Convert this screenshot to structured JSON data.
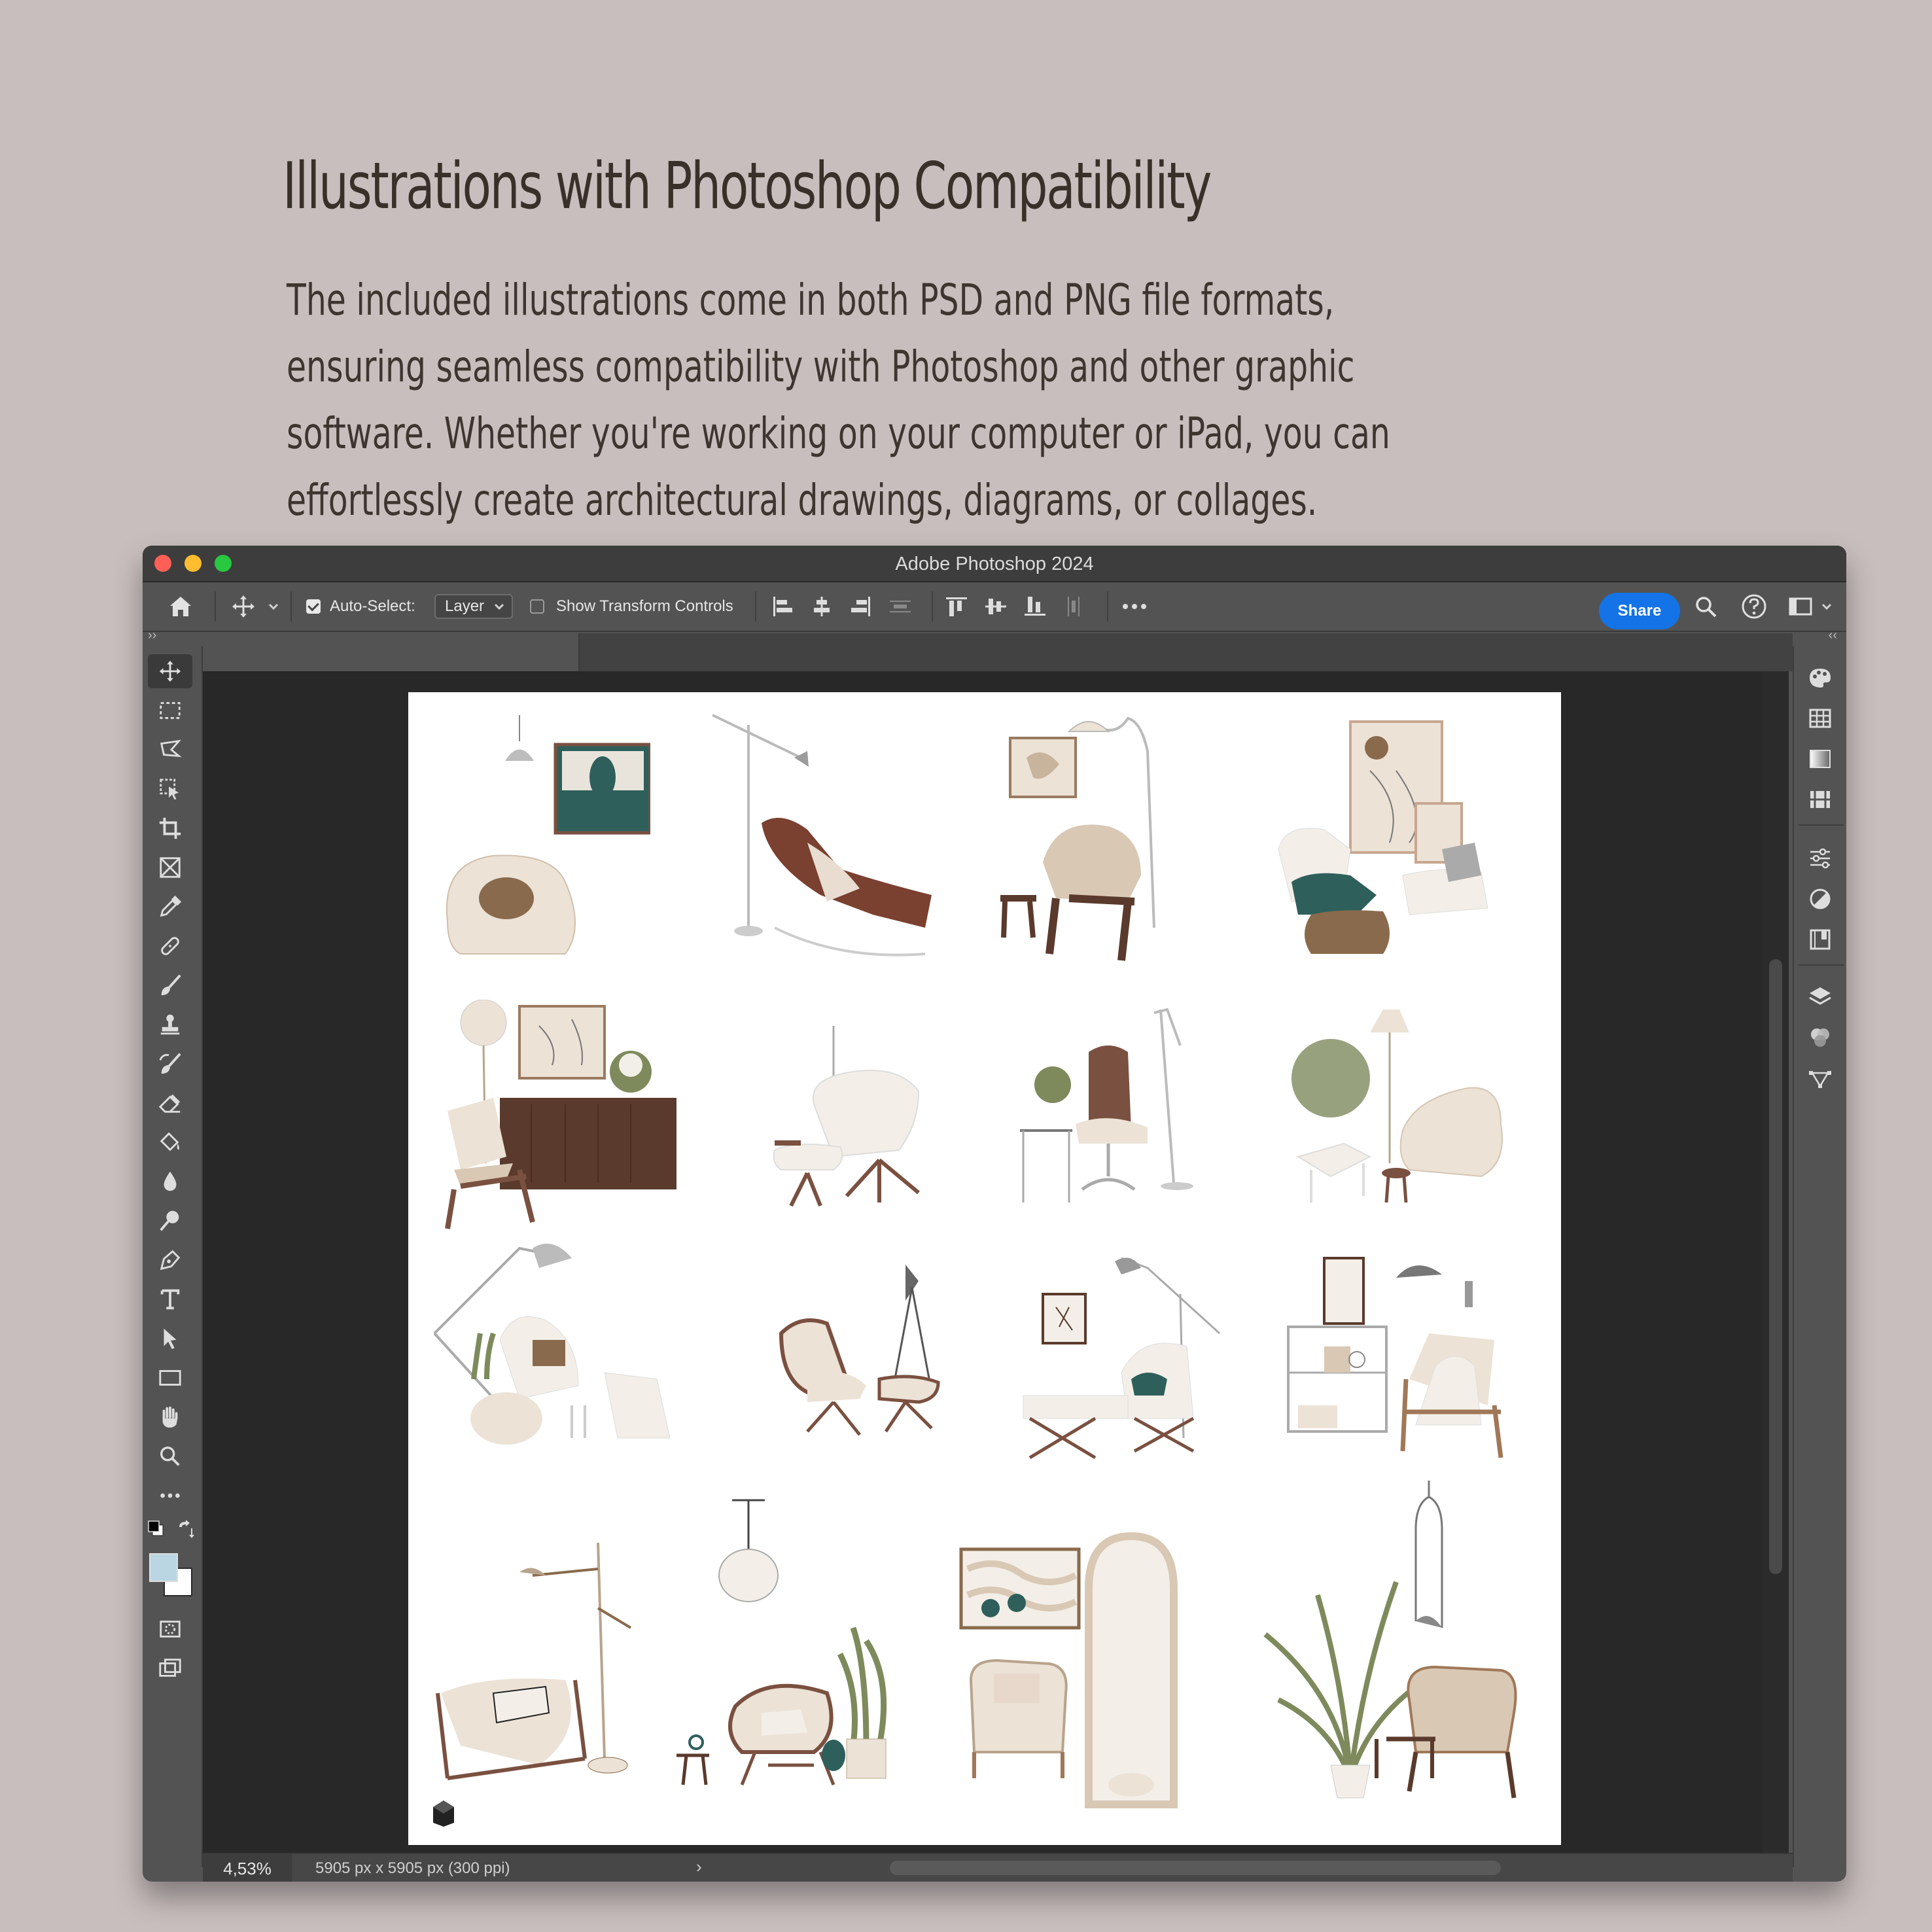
{
  "hero": {
    "title": "Illustrations with Photoshop Compatibility",
    "description": "The included illustrations come in both PSD and PNG file formats, ensuring seamless compatibility with Photoshop and other graphic software. Whether you're working on your computer or iPad, you can effortlessly create architectural drawings, diagrams, or collages."
  },
  "window": {
    "title": "Adobe Photoshop 2024"
  },
  "options_bar": {
    "auto_select_label": "Auto-Select:",
    "auto_select_checked": true,
    "layer_select_value": "Layer",
    "show_transform_label": "Show Transform Controls",
    "show_transform_checked": false,
    "share_label": "Share"
  },
  "toolbar": {
    "tools": [
      "move-tool",
      "rectangular-marquee-tool",
      "lasso-tool",
      "object-selection-tool",
      "crop-tool",
      "frame-tool",
      "eyedropper-tool",
      "spot-healing-tool",
      "brush-tool",
      "clone-stamp-tool",
      "history-brush-tool",
      "eraser-tool",
      "paint-bucket-tool",
      "blur-tool",
      "dodge-tool",
      "pen-tool",
      "type-tool",
      "path-selection-tool",
      "rectangle-tool",
      "hand-tool",
      "zoom-tool",
      "more-tools"
    ],
    "foreground_color": "#000000",
    "swatch_color": "#b9d6e2"
  },
  "right_panel": {
    "icons": [
      "color-panel-icon",
      "swatches-panel-icon",
      "gradients-panel-icon",
      "patterns-panel-icon",
      "adjustments-panel-icon",
      "properties-panel-icon",
      "libraries-panel-icon",
      "layers-panel-icon",
      "channels-panel-icon",
      "paths-panel-icon"
    ]
  },
  "status_bar": {
    "zoom": "4,53%",
    "document_info": "5905 px x 5905 px (300 ppi)",
    "arrow": "›"
  },
  "canvas": {
    "illustrations": [
      "pendant-lamp-beanbag-art",
      "chaise-lounge-floor-lamp",
      "armchair-stool-lamp",
      "cushions-laptop-frames",
      "sideboard-armchair-flowers",
      "lounge-chair-ottoman",
      "swivel-chair-side-table",
      "beanbag-plant-tripod-lamp",
      "arc-lamp-chair-plants",
      "eames-lounge-chair",
      "barcelona-daybed",
      "cart-armchair-wall-lamp",
      "sling-chair-floor-lamp",
      "papasan-chair-palm",
      "rattan-chair-arch-mirror",
      "palm-armchair-pendant"
    ],
    "palette": {
      "cream": "#ece2d6",
      "beige": "#d9c8b4",
      "brown": "#7a5040",
      "dark_brown": "#5a3a2c",
      "teal": "#2f5f5a",
      "grey": "#9c9c9c",
      "green": "#7e8a5c"
    }
  }
}
